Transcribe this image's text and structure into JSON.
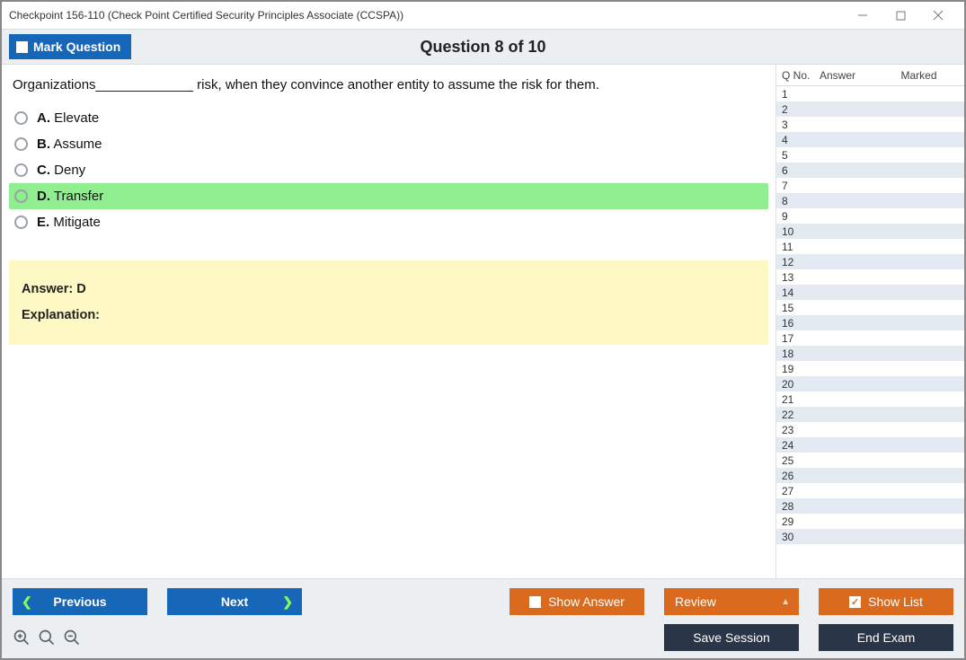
{
  "window": {
    "title": "Checkpoint 156-110 (Check Point Certified Security Principles Associate (CCSPA))"
  },
  "header": {
    "mark_label": "Mark Question",
    "counter": "Question 8 of 10"
  },
  "question": {
    "text": "Organizations_____________ risk, when they convince another entity to assume the risk for them.",
    "choices": [
      {
        "letter": "A.",
        "text": "Elevate",
        "correct": false
      },
      {
        "letter": "B.",
        "text": "Assume",
        "correct": false
      },
      {
        "letter": "C.",
        "text": "Deny",
        "correct": false
      },
      {
        "letter": "D.",
        "text": "Transfer",
        "correct": true
      },
      {
        "letter": "E.",
        "text": "Mitigate",
        "correct": false
      }
    ],
    "answer_label": "Answer: D",
    "explanation_label": "Explanation:"
  },
  "sidebar": {
    "headers": {
      "qno": "Q No.",
      "answer": "Answer",
      "marked": "Marked"
    },
    "rows": [
      1,
      2,
      3,
      4,
      5,
      6,
      7,
      8,
      9,
      10,
      11,
      12,
      13,
      14,
      15,
      16,
      17,
      18,
      19,
      20,
      21,
      22,
      23,
      24,
      25,
      26,
      27,
      28,
      29,
      30
    ]
  },
  "footer": {
    "previous": "Previous",
    "next": "Next",
    "show_answer": "Show Answer",
    "review": "Review",
    "show_list": "Show List",
    "save_session": "Save Session",
    "end_exam": "End Exam"
  }
}
